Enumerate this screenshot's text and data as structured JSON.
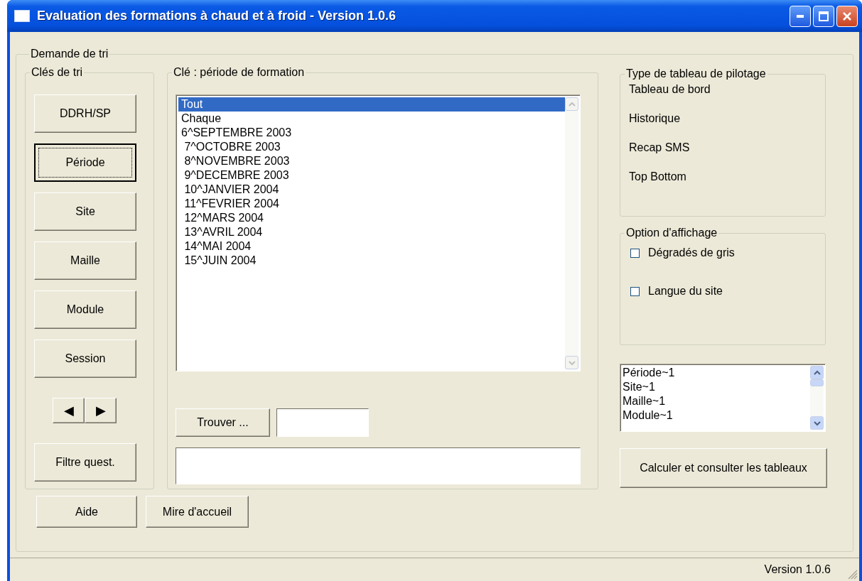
{
  "window": {
    "title": "Evaluation des formations à chaud et à froid - Version 1.0.6"
  },
  "request_group": {
    "label": "Demande de tri"
  },
  "sort_keys": {
    "label": "Clés de tri",
    "buttons": [
      {
        "label": "DDRH/SP",
        "focused": false
      },
      {
        "label": "Période",
        "focused": true
      },
      {
        "label": "Site",
        "focused": false
      },
      {
        "label": "Maille",
        "focused": false
      },
      {
        "label": "Module",
        "focused": false
      },
      {
        "label": "Session",
        "focused": false
      }
    ],
    "arrows": [
      "◀",
      "▶"
    ],
    "filter_button": "Filtre quest."
  },
  "period_key": {
    "label": "Clé : période de formation",
    "items": [
      {
        "text": "Tout",
        "selected": true
      },
      {
        "text": "Chaque",
        "selected": false
      },
      {
        "text": "6^SEPTEMBRE 2003",
        "selected": false
      },
      {
        "text": " 7^OCTOBRE 2003",
        "selected": false
      },
      {
        "text": " 8^NOVEMBRE 2003",
        "selected": false
      },
      {
        "text": " 9^DECEMBRE 2003",
        "selected": false
      },
      {
        "text": " 10^JANVIER 2004",
        "selected": false
      },
      {
        "text": " 11^FEVRIER 2004",
        "selected": false
      },
      {
        "text": " 12^MARS 2004",
        "selected": false
      },
      {
        "text": " 13^AVRIL 2004",
        "selected": false
      },
      {
        "text": " 14^MAI 2004",
        "selected": false
      },
      {
        "text": " 15^JUIN 2004",
        "selected": false
      }
    ],
    "find_button": "Trouver ..."
  },
  "dashboard_type": {
    "label": "Type de tableau de pilotage",
    "options": [
      "Tableau de bord",
      "Historique",
      "Recap SMS",
      "Top Bottom"
    ]
  },
  "display_options": {
    "label": "Option d'affichage",
    "checkboxes": [
      {
        "label": "Dégradés de gris",
        "checked": false
      },
      {
        "label": "Langue du site",
        "checked": false
      }
    ]
  },
  "selected_keys": [
    "Période~1",
    "Site~1",
    "Maille~1",
    "Module~1"
  ],
  "compute_button": "Calculer et consulter les tableaux",
  "bottom_buttons": [
    "Aide",
    "Mire d'accueil"
  ],
  "status_bar": {
    "text": "Version 1.0.6"
  }
}
